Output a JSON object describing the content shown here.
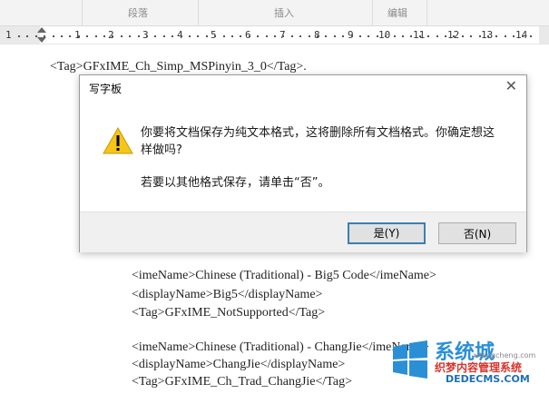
{
  "ribbon": {
    "groups": [
      "段落",
      "插入",
      "编辑"
    ]
  },
  "ruler": {
    "numbers": [
      "1",
      "1",
      "2",
      "3",
      "4",
      "5",
      "6",
      "7",
      "8",
      "9",
      "10",
      "11",
      "12",
      "13",
      "14"
    ]
  },
  "document": {
    "line_top": "<Tag>GFxIME_Ch_Simp_MSPinyin_3_0</Tag>.",
    "lines_bottom": [
      "<imeName>Chinese (Traditional) - Big5 Code</imeName>",
      "<displayName>Big5</displayName>",
      "<Tag>GFxIME_NotSupported</Tag>",
      "",
      "<imeName>Chinese (Traditional) - ChangJie</imeName>",
      "<displayName>ChangJie</displayName>",
      "<Tag>GFxIME_Ch_Trad_ChangJie</Tag>"
    ]
  },
  "dialog": {
    "title": "写字板",
    "close": "✕",
    "icon": "warning-icon",
    "message": "你要将文档保存为纯文本格式，这将删除所有文档格式。你确定想这样做吗?",
    "hint": "若要以其他格式保存，请单击“否”。",
    "yes_label": "是(Y)",
    "no_label": "否(N)"
  },
  "watermark": {
    "brand": "系统城",
    "line1": "织梦内容管理系统",
    "line2": "DEDECMS.COM",
    "line3": "xitongcheng.com",
    "color": "#1d6fb8"
  }
}
